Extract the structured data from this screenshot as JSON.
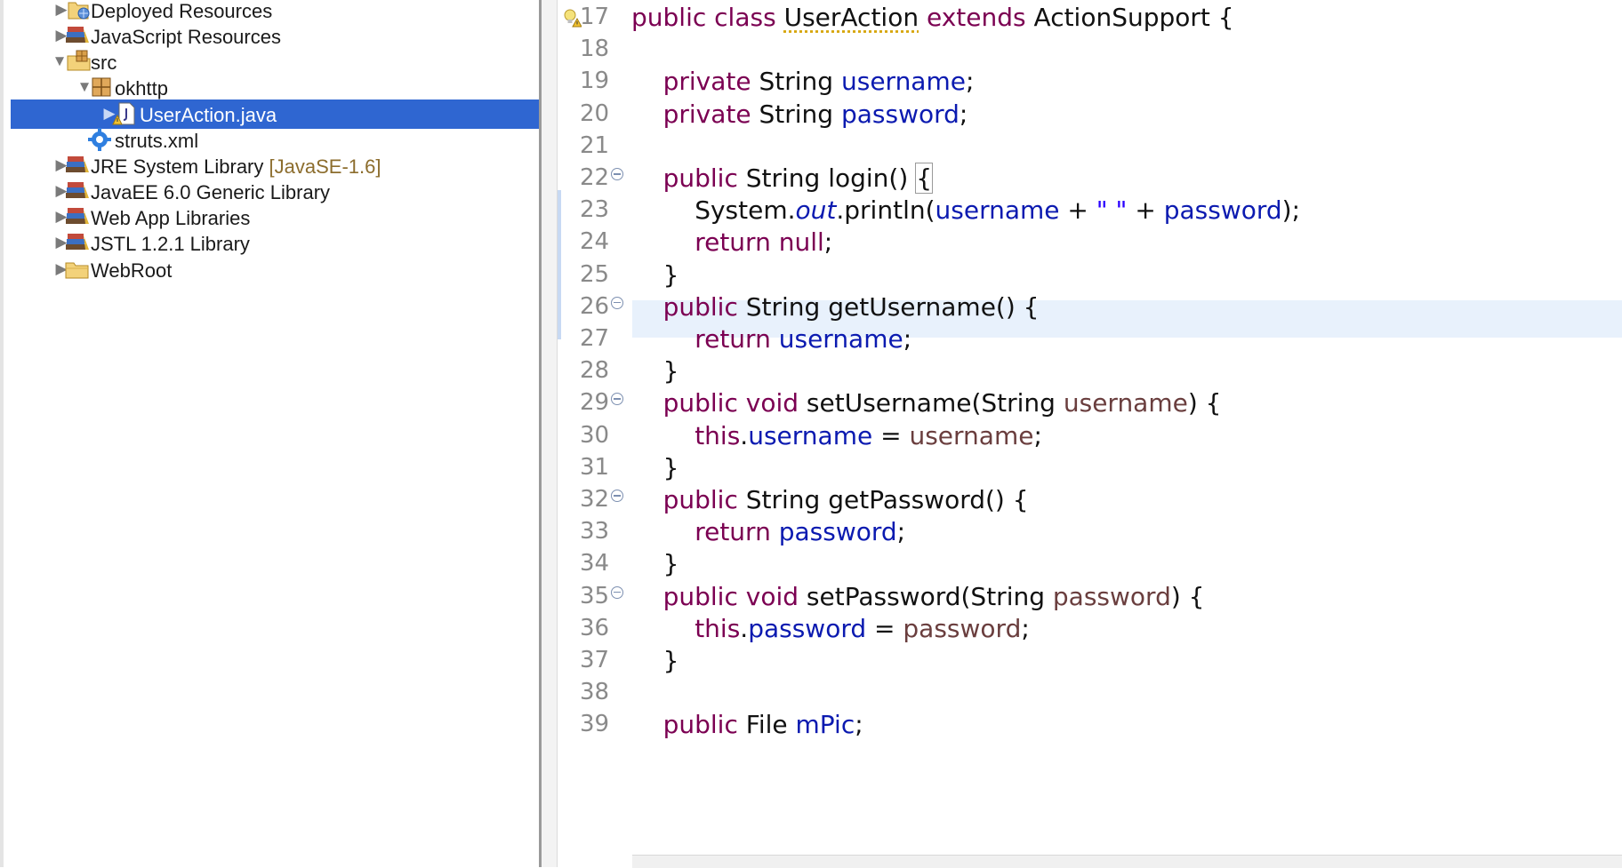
{
  "explorer": {
    "items": [
      {
        "label": "Deployed Resources",
        "decoration": "",
        "icon": "deployed-resources-icon",
        "expanded": false
      },
      {
        "label": "JavaScript Resources",
        "decoration": "",
        "icon": "library-icon",
        "expanded": false
      },
      {
        "label": "src",
        "decoration": "",
        "icon": "source-folder-icon",
        "expanded": true
      },
      {
        "label": "okhttp",
        "decoration": "",
        "icon": "package-icon",
        "expanded": true
      },
      {
        "label": "UserAction.java",
        "decoration": "",
        "icon": "java-file-icon",
        "expanded": false,
        "selected": true
      },
      {
        "label": "struts.xml",
        "decoration": "",
        "icon": "xml-gear-icon"
      },
      {
        "label": "JRE System Library",
        "decoration": "[JavaSE-1.6]",
        "icon": "library-icon",
        "expanded": false
      },
      {
        "label": "JavaEE 6.0 Generic Library",
        "decoration": "",
        "icon": "library-icon",
        "expanded": false
      },
      {
        "label": "Web App Libraries",
        "decoration": "",
        "icon": "library-icon",
        "expanded": false
      },
      {
        "label": "JSTL 1.2.1 Library",
        "decoration": "",
        "icon": "library-icon",
        "expanded": false
      },
      {
        "label": "WebRoot",
        "decoration": "",
        "icon": "folder-icon",
        "expanded": false
      }
    ]
  },
  "editor": {
    "lines": [
      {
        "num": "17",
        "tokens": [
          [
            "kw",
            "public"
          ],
          [
            "t",
            " "
          ],
          [
            "kw",
            "class"
          ],
          [
            "t",
            " "
          ],
          [
            "warn",
            "UserAction"
          ],
          [
            "t",
            " "
          ],
          [
            "kw",
            "extends"
          ],
          [
            "t",
            " ActionSupport {"
          ]
        ]
      },
      {
        "num": "18",
        "tokens": []
      },
      {
        "num": "19",
        "tokens": [
          [
            "t",
            "    "
          ],
          [
            "kw",
            "private"
          ],
          [
            "t",
            " String "
          ],
          [
            "fld",
            "username"
          ],
          [
            "t",
            ";"
          ]
        ]
      },
      {
        "num": "20",
        "tokens": [
          [
            "t",
            "    "
          ],
          [
            "kw",
            "private"
          ],
          [
            "t",
            " String "
          ],
          [
            "fld",
            "password"
          ],
          [
            "t",
            ";"
          ]
        ]
      },
      {
        "num": "21",
        "tokens": []
      },
      {
        "num": "22",
        "fold": true,
        "tokens": [
          [
            "t",
            "    "
          ],
          [
            "kw",
            "public"
          ],
          [
            "t",
            " String login() "
          ],
          [
            "box",
            "{"
          ]
        ]
      },
      {
        "num": "23",
        "tokens": [
          [
            "t",
            "        System."
          ],
          [
            "sfld",
            "out"
          ],
          [
            "t",
            ".println("
          ],
          [
            "fld",
            "username"
          ],
          [
            "t",
            " + "
          ],
          [
            "str",
            "\" \""
          ],
          [
            "t",
            " + "
          ],
          [
            "fld",
            "password"
          ],
          [
            "t",
            ");"
          ]
        ]
      },
      {
        "num": "24",
        "tokens": [
          [
            "t",
            "        "
          ],
          [
            "kw",
            "return"
          ],
          [
            "t",
            " "
          ],
          [
            "kw",
            "null"
          ],
          [
            "t",
            ";"
          ]
        ]
      },
      {
        "num": "25",
        "tokens": [
          [
            "t",
            "    }"
          ]
        ]
      },
      {
        "num": "26",
        "fold": true,
        "tokens": [
          [
            "t",
            "    "
          ],
          [
            "kw",
            "public"
          ],
          [
            "t",
            " String getUsername() {"
          ]
        ]
      },
      {
        "num": "27",
        "tokens": [
          [
            "t",
            "        "
          ],
          [
            "kw",
            "return"
          ],
          [
            "t",
            " "
          ],
          [
            "fld",
            "username"
          ],
          [
            "t",
            ";"
          ]
        ]
      },
      {
        "num": "28",
        "tokens": [
          [
            "t",
            "    }"
          ]
        ]
      },
      {
        "num": "29",
        "fold": true,
        "tokens": [
          [
            "t",
            "    "
          ],
          [
            "kw",
            "public"
          ],
          [
            "t",
            " "
          ],
          [
            "kw",
            "void"
          ],
          [
            "t",
            " setUsername(String "
          ],
          [
            "par",
            "username"
          ],
          [
            "t",
            ") {"
          ]
        ]
      },
      {
        "num": "30",
        "tokens": [
          [
            "t",
            "        "
          ],
          [
            "kw",
            "this"
          ],
          [
            "t",
            "."
          ],
          [
            "fld",
            "username"
          ],
          [
            "t",
            " = "
          ],
          [
            "par",
            "username"
          ],
          [
            "t",
            ";"
          ]
        ]
      },
      {
        "num": "31",
        "tokens": [
          [
            "t",
            "    }"
          ]
        ]
      },
      {
        "num": "32",
        "fold": true,
        "tokens": [
          [
            "t",
            "    "
          ],
          [
            "kw",
            "public"
          ],
          [
            "t",
            " String getPassword() {"
          ]
        ]
      },
      {
        "num": "33",
        "tokens": [
          [
            "t",
            "        "
          ],
          [
            "kw",
            "return"
          ],
          [
            "t",
            " "
          ],
          [
            "fld",
            "password"
          ],
          [
            "t",
            ";"
          ]
        ]
      },
      {
        "num": "34",
        "tokens": [
          [
            "t",
            "    }"
          ]
        ]
      },
      {
        "num": "35",
        "fold": true,
        "tokens": [
          [
            "t",
            "    "
          ],
          [
            "kw",
            "public"
          ],
          [
            "t",
            " "
          ],
          [
            "kw",
            "void"
          ],
          [
            "t",
            " setPassword(String "
          ],
          [
            "par",
            "password"
          ],
          [
            "t",
            ") {"
          ]
        ]
      },
      {
        "num": "36",
        "tokens": [
          [
            "t",
            "        "
          ],
          [
            "kw",
            "this"
          ],
          [
            "t",
            "."
          ],
          [
            "fld",
            "password"
          ],
          [
            "t",
            " = "
          ],
          [
            "par",
            "password"
          ],
          [
            "t",
            ";"
          ]
        ]
      },
      {
        "num": "37",
        "tokens": [
          [
            "t",
            "    }"
          ]
        ]
      },
      {
        "num": "38",
        "tokens": []
      },
      {
        "num": "39",
        "tokens": [
          [
            "t",
            "    "
          ],
          [
            "kw",
            "public"
          ],
          [
            "t",
            " File "
          ],
          [
            "fld",
            "mPic"
          ],
          [
            "t",
            ";"
          ]
        ]
      }
    ]
  },
  "colors": {
    "keyword": "#7b0052",
    "field": "#0b1ab0",
    "string": "#2a00ff",
    "parameter": "#6a3e3e",
    "selection": "#2f66d1",
    "current_line": "#e8f1fc"
  }
}
